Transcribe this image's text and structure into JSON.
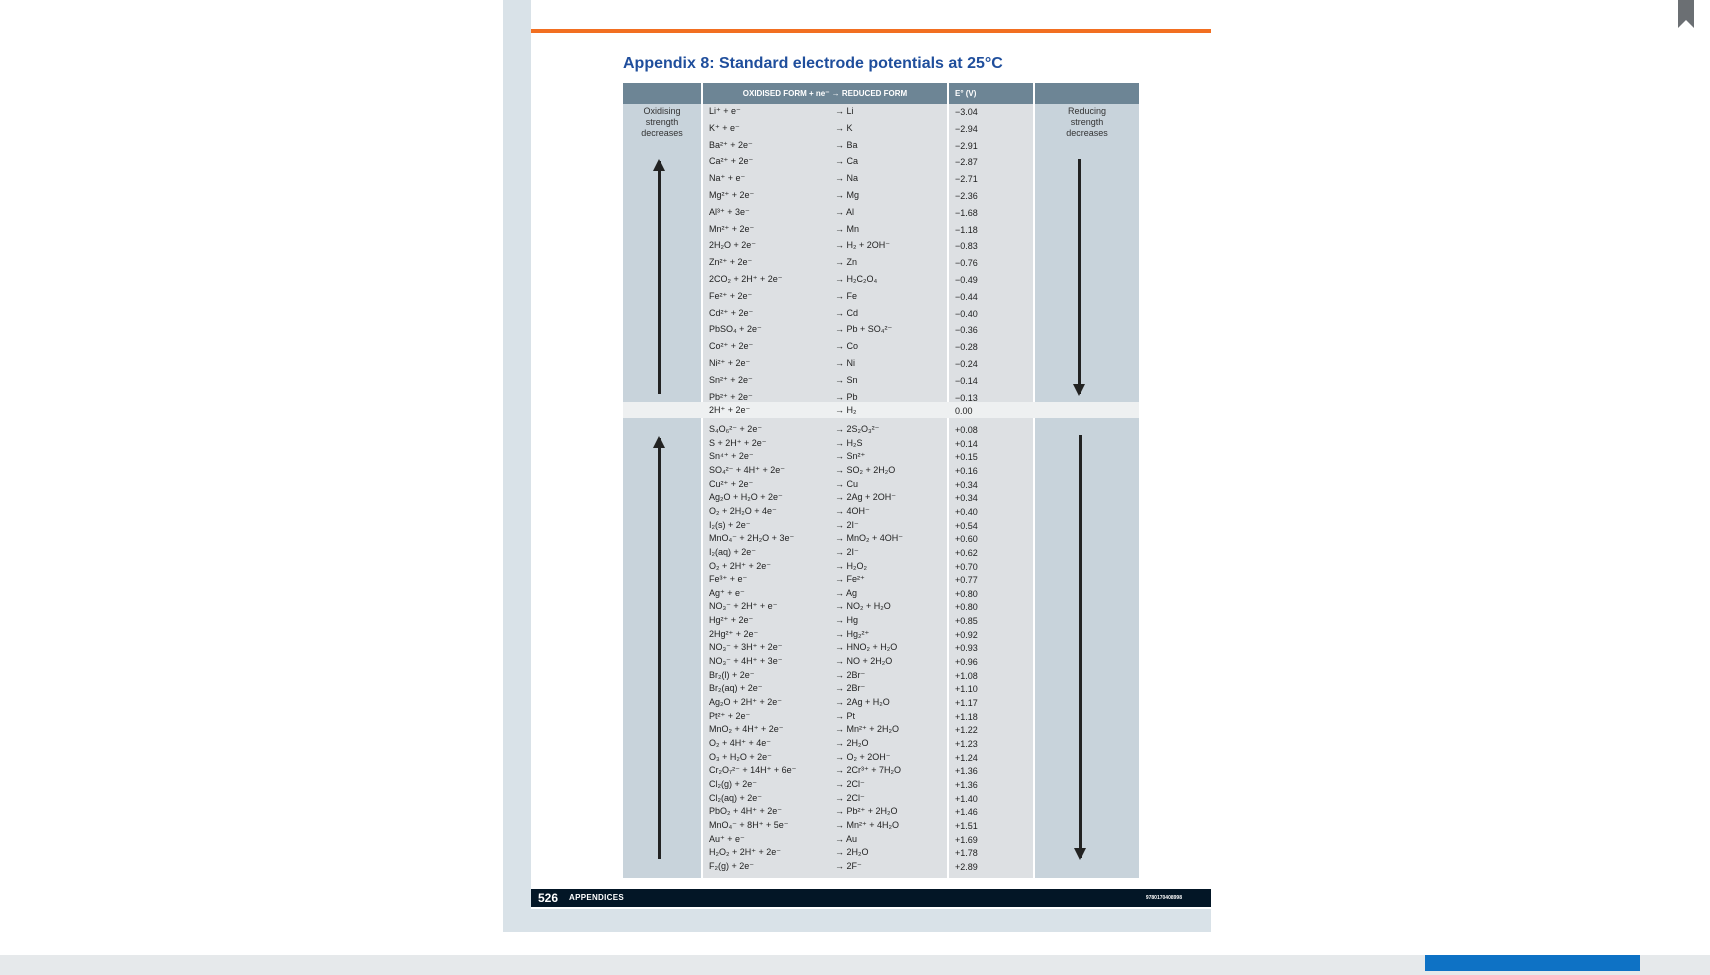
{
  "page": {
    "title": "Appendix 8: Standard electrode potentials at 25°C",
    "footer_page_number": "526",
    "footer_section": "APPENDICES",
    "footer_isbn": "9780170408998"
  },
  "table": {
    "headers": [
      "OXIDISED FORM + ne⁻ → REDUCED FORM",
      "E° (V)"
    ],
    "left_label": "Oxidising strength decreases",
    "right_label": "Reducing strength decreases",
    "rows": [
      {
        "ox": "Li⁺ + e⁻",
        "red": "→ Li",
        "e": "−3.04"
      },
      {
        "ox": "K⁺ + e⁻",
        "red": "→ K",
        "e": "−2.94"
      },
      {
        "ox": "Ba²⁺ + 2e⁻",
        "red": "→ Ba",
        "e": "−2.91"
      },
      {
        "ox": "Ca²⁺ + 2e⁻",
        "red": "→ Ca",
        "e": "−2.87"
      },
      {
        "ox": "Na⁺ + e⁻",
        "red": "→ Na",
        "e": "−2.71"
      },
      {
        "ox": "Mg²⁺ + 2e⁻",
        "red": "→ Mg",
        "e": "−2.36"
      },
      {
        "ox": "Al³⁺ + 3e⁻",
        "red": "→ Al",
        "e": "−1.68"
      },
      {
        "ox": "Mn²⁺ + 2e⁻",
        "red": "→ Mn",
        "e": "−1.18"
      },
      {
        "ox": "2H₂O + 2e⁻",
        "red": "→ H₂ + 2OH⁻",
        "e": "−0.83"
      },
      {
        "ox": "Zn²⁺ + 2e⁻",
        "red": "→ Zn",
        "e": "−0.76"
      },
      {
        "ox": "2CO₂ + 2H⁺ + 2e⁻",
        "red": "→ H₂C₂O₄",
        "e": "−0.49"
      },
      {
        "ox": "Fe²⁺ + 2e⁻",
        "red": "→ Fe",
        "e": "−0.44"
      },
      {
        "ox": "Cd²⁺ + 2e⁻",
        "red": "→ Cd",
        "e": "−0.40"
      },
      {
        "ox": "PbSO₄ + 2e⁻",
        "red": "→ Pb + SO₄²⁻",
        "e": "−0.36"
      },
      {
        "ox": "Co²⁺ + 2e⁻",
        "red": "→ Co",
        "e": "−0.28"
      },
      {
        "ox": "Ni²⁺ + 2e⁻",
        "red": "→ Ni",
        "e": "−0.24"
      },
      {
        "ox": "Sn²⁺ + 2e⁻",
        "red": "→ Sn",
        "e": "−0.14"
      },
      {
        "ox": "Pb²⁺ + 2e⁻",
        "red": "→ Pb",
        "e": "−0.13"
      },
      {
        "ox": "2H⁺ + 2e⁻",
        "red": "→ H₂",
        "e": "0.00"
      },
      {
        "ox": "S₄O₆²⁻ + 2e⁻",
        "red": "→ 2S₂O₃²⁻",
        "e": "+0.08"
      },
      {
        "ox": "S + 2H⁺ + 2e⁻",
        "red": "→ H₂S",
        "e": "+0.14"
      },
      {
        "ox": "Sn⁴⁺ + 2e⁻",
        "red": "→ Sn²⁺",
        "e": "+0.15"
      },
      {
        "ox": "SO₄²⁻ + 4H⁺ + 2e⁻",
        "red": "→ SO₂ + 2H₂O",
        "e": "+0.16"
      },
      {
        "ox": "Cu²⁺ + 2e⁻",
        "red": "→ Cu",
        "e": "+0.34"
      },
      {
        "ox": "Ag₂O + H₂O + 2e⁻",
        "red": "→ 2Ag + 2OH⁻",
        "e": "+0.34"
      },
      {
        "ox": "O₂ + 2H₂O + 4e⁻",
        "red": "→ 4OH⁻",
        "e": "+0.40"
      },
      {
        "ox": "I₂(s) + 2e⁻",
        "red": "→ 2I⁻",
        "e": "+0.54"
      },
      {
        "ox": "MnO₄⁻ + 2H₂O + 3e⁻",
        "red": "→ MnO₂ + 4OH⁻",
        "e": "+0.60"
      },
      {
        "ox": "I₂(aq) + 2e⁻",
        "red": "→ 2I⁻",
        "e": "+0.62"
      },
      {
        "ox": "O₂ + 2H⁺ + 2e⁻",
        "red": "→ H₂O₂",
        "e": "+0.70"
      },
      {
        "ox": "Fe³⁺ + e⁻",
        "red": "→ Fe²⁺",
        "e": "+0.77"
      },
      {
        "ox": "Ag⁺ + e⁻",
        "red": "→ Ag",
        "e": "+0.80"
      },
      {
        "ox": "NO₃⁻ + 2H⁺ + e⁻",
        "red": "→ NO₂ + H₂O",
        "e": "+0.80"
      },
      {
        "ox": "Hg²⁺ + 2e⁻",
        "red": "→ Hg",
        "e": "+0.85"
      },
      {
        "ox": "2Hg²⁺ + 2e⁻",
        "red": "→ Hg₂²⁺",
        "e": "+0.92"
      },
      {
        "ox": "NO₃⁻ + 3H⁺ + 2e⁻",
        "red": "→ HNO₂ + H₂O",
        "e": "+0.93"
      },
      {
        "ox": "NO₃⁻ + 4H⁺ + 3e⁻",
        "red": "→ NO + 2H₂O",
        "e": "+0.96"
      },
      {
        "ox": "Br₂(l) + 2e⁻",
        "red": "→ 2Br⁻",
        "e": "+1.08"
      },
      {
        "ox": "Br₂(aq) + 2e⁻",
        "red": "→ 2Br⁻",
        "e": "+1.10"
      },
      {
        "ox": "Ag₂O + 2H⁺ + 2e⁻",
        "red": "→ 2Ag + H₂O",
        "e": "+1.17"
      },
      {
        "ox": "Pt²⁺ + 2e⁻",
        "red": "→ Pt",
        "e": "+1.18"
      },
      {
        "ox": "MnO₂ + 4H⁺ + 2e⁻",
        "red": "→ Mn²⁺ + 2H₂O",
        "e": "+1.22"
      },
      {
        "ox": "O₂ + 4H⁺ + 4e⁻",
        "red": "→ 2H₂O",
        "e": "+1.23"
      },
      {
        "ox": "O₃ + H₂O + 2e⁻",
        "red": "→ O₂ + 2OH⁻",
        "e": "+1.24"
      },
      {
        "ox": "Cr₂O₇²⁻ + 14H⁺ + 6e⁻",
        "red": "→ 2Cr³⁺ + 7H₂O",
        "e": "+1.36"
      },
      {
        "ox": "Cl₂(g) + 2e⁻",
        "red": "→ 2Cl⁻",
        "e": "+1.36"
      },
      {
        "ox": "Cl₂(aq) + 2e⁻",
        "red": "→ 2Cl⁻",
        "e": "+1.40"
      },
      {
        "ox": "PbO₂ + 4H⁺ + 2e⁻",
        "red": "→ Pb²⁺ + 2H₂O",
        "e": "+1.46"
      },
      {
        "ox": "MnO₄⁻ + 8H⁺ + 5e⁻",
        "red": "→ Mn²⁺ + 4H₂O",
        "e": "+1.51"
      },
      {
        "ox": "Au⁺ + e⁻",
        "red": "→ Au",
        "e": "+1.69"
      },
      {
        "ox": "H₂O₂ + 2H⁺ + 2e⁻",
        "red": "→ 2H₂O",
        "e": "+1.78"
      },
      {
        "ox": "F₂(g) + 2e⁻",
        "red": "→ 2F⁻",
        "e": "+2.89"
      }
    ]
  },
  "colors": {
    "title": "#1f4e9c",
    "accent_bar": "#f26f21",
    "header_bg": "#6d8595",
    "footer_bg": "#031626"
  },
  "icons": {
    "bookmark": "bookmark-icon",
    "arrow_up": "arrow-up-icon",
    "arrow_down": "arrow-down-icon"
  }
}
